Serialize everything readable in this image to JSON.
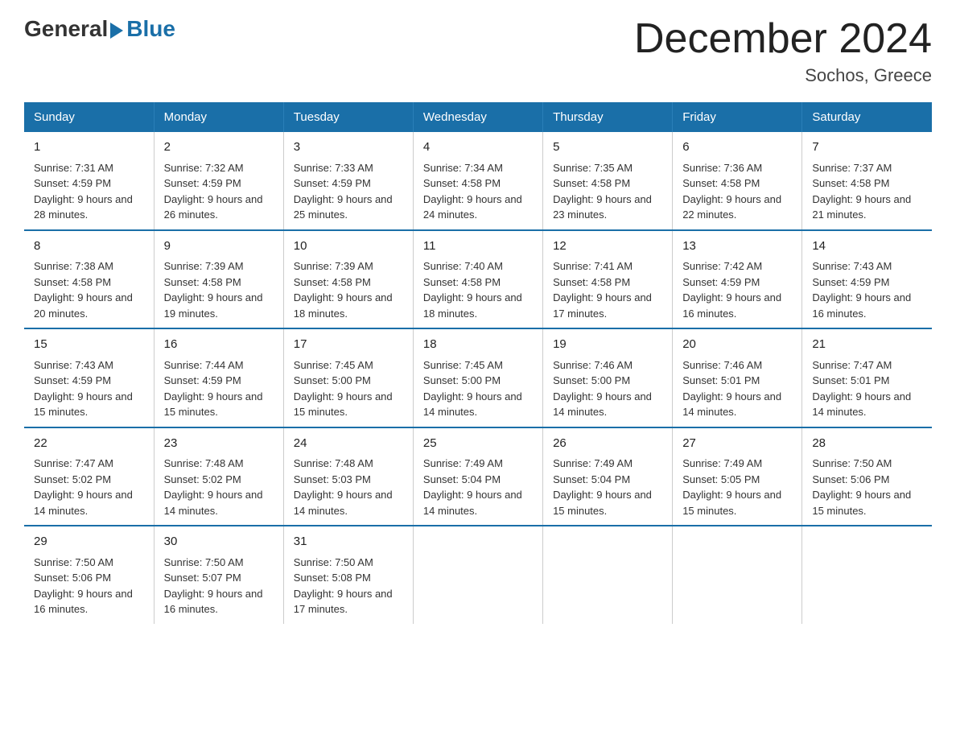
{
  "logo": {
    "general": "General",
    "blue": "Blue"
  },
  "title": "December 2024",
  "subtitle": "Sochos, Greece",
  "days_of_week": [
    "Sunday",
    "Monday",
    "Tuesday",
    "Wednesday",
    "Thursday",
    "Friday",
    "Saturday"
  ],
  "weeks": [
    [
      {
        "day": "1",
        "sunrise": "7:31 AM",
        "sunset": "4:59 PM",
        "daylight": "9 hours and 28 minutes."
      },
      {
        "day": "2",
        "sunrise": "7:32 AM",
        "sunset": "4:59 PM",
        "daylight": "9 hours and 26 minutes."
      },
      {
        "day": "3",
        "sunrise": "7:33 AM",
        "sunset": "4:59 PM",
        "daylight": "9 hours and 25 minutes."
      },
      {
        "day": "4",
        "sunrise": "7:34 AM",
        "sunset": "4:58 PM",
        "daylight": "9 hours and 24 minutes."
      },
      {
        "day": "5",
        "sunrise": "7:35 AM",
        "sunset": "4:58 PM",
        "daylight": "9 hours and 23 minutes."
      },
      {
        "day": "6",
        "sunrise": "7:36 AM",
        "sunset": "4:58 PM",
        "daylight": "9 hours and 22 minutes."
      },
      {
        "day": "7",
        "sunrise": "7:37 AM",
        "sunset": "4:58 PM",
        "daylight": "9 hours and 21 minutes."
      }
    ],
    [
      {
        "day": "8",
        "sunrise": "7:38 AM",
        "sunset": "4:58 PM",
        "daylight": "9 hours and 20 minutes."
      },
      {
        "day": "9",
        "sunrise": "7:39 AM",
        "sunset": "4:58 PM",
        "daylight": "9 hours and 19 minutes."
      },
      {
        "day": "10",
        "sunrise": "7:39 AM",
        "sunset": "4:58 PM",
        "daylight": "9 hours and 18 minutes."
      },
      {
        "day": "11",
        "sunrise": "7:40 AM",
        "sunset": "4:58 PM",
        "daylight": "9 hours and 18 minutes."
      },
      {
        "day": "12",
        "sunrise": "7:41 AM",
        "sunset": "4:58 PM",
        "daylight": "9 hours and 17 minutes."
      },
      {
        "day": "13",
        "sunrise": "7:42 AM",
        "sunset": "4:59 PM",
        "daylight": "9 hours and 16 minutes."
      },
      {
        "day": "14",
        "sunrise": "7:43 AM",
        "sunset": "4:59 PM",
        "daylight": "9 hours and 16 minutes."
      }
    ],
    [
      {
        "day": "15",
        "sunrise": "7:43 AM",
        "sunset": "4:59 PM",
        "daylight": "9 hours and 15 minutes."
      },
      {
        "day": "16",
        "sunrise": "7:44 AM",
        "sunset": "4:59 PM",
        "daylight": "9 hours and 15 minutes."
      },
      {
        "day": "17",
        "sunrise": "7:45 AM",
        "sunset": "5:00 PM",
        "daylight": "9 hours and 15 minutes."
      },
      {
        "day": "18",
        "sunrise": "7:45 AM",
        "sunset": "5:00 PM",
        "daylight": "9 hours and 14 minutes."
      },
      {
        "day": "19",
        "sunrise": "7:46 AM",
        "sunset": "5:00 PM",
        "daylight": "9 hours and 14 minutes."
      },
      {
        "day": "20",
        "sunrise": "7:46 AM",
        "sunset": "5:01 PM",
        "daylight": "9 hours and 14 minutes."
      },
      {
        "day": "21",
        "sunrise": "7:47 AM",
        "sunset": "5:01 PM",
        "daylight": "9 hours and 14 minutes."
      }
    ],
    [
      {
        "day": "22",
        "sunrise": "7:47 AM",
        "sunset": "5:02 PM",
        "daylight": "9 hours and 14 minutes."
      },
      {
        "day": "23",
        "sunrise": "7:48 AM",
        "sunset": "5:02 PM",
        "daylight": "9 hours and 14 minutes."
      },
      {
        "day": "24",
        "sunrise": "7:48 AM",
        "sunset": "5:03 PM",
        "daylight": "9 hours and 14 minutes."
      },
      {
        "day": "25",
        "sunrise": "7:49 AM",
        "sunset": "5:04 PM",
        "daylight": "9 hours and 14 minutes."
      },
      {
        "day": "26",
        "sunrise": "7:49 AM",
        "sunset": "5:04 PM",
        "daylight": "9 hours and 15 minutes."
      },
      {
        "day": "27",
        "sunrise": "7:49 AM",
        "sunset": "5:05 PM",
        "daylight": "9 hours and 15 minutes."
      },
      {
        "day": "28",
        "sunrise": "7:50 AM",
        "sunset": "5:06 PM",
        "daylight": "9 hours and 15 minutes."
      }
    ],
    [
      {
        "day": "29",
        "sunrise": "7:50 AM",
        "sunset": "5:06 PM",
        "daylight": "9 hours and 16 minutes."
      },
      {
        "day": "30",
        "sunrise": "7:50 AM",
        "sunset": "5:07 PM",
        "daylight": "9 hours and 16 minutes."
      },
      {
        "day": "31",
        "sunrise": "7:50 AM",
        "sunset": "5:08 PM",
        "daylight": "9 hours and 17 minutes."
      },
      null,
      null,
      null,
      null
    ]
  ]
}
